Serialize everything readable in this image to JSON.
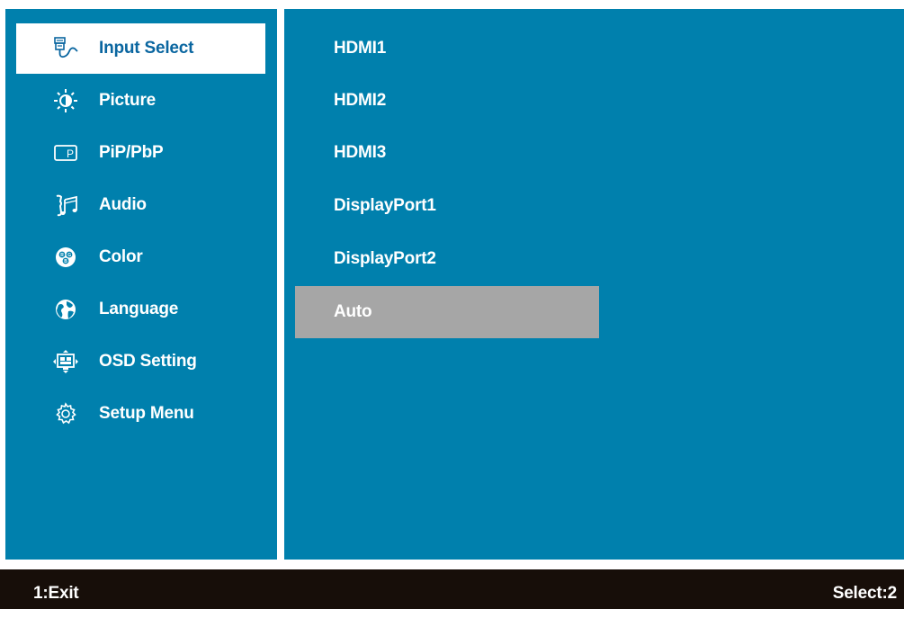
{
  "menu": {
    "items": [
      {
        "label": "Input Select",
        "icon": "input-select-icon",
        "selected": true
      },
      {
        "label": "Picture",
        "icon": "brightness-icon",
        "selected": false
      },
      {
        "label": "PiP/PbP",
        "icon": "pip-icon",
        "selected": false
      },
      {
        "label": "Audio",
        "icon": "audio-icon",
        "selected": false
      },
      {
        "label": "Color",
        "icon": "rgb-color-icon",
        "selected": false
      },
      {
        "label": "Language",
        "icon": "globe-icon",
        "selected": false
      },
      {
        "label": "OSD Setting",
        "icon": "osd-setting-icon",
        "selected": false
      },
      {
        "label": "Setup Menu",
        "icon": "gear-icon",
        "selected": false
      }
    ]
  },
  "input_options": {
    "items": [
      {
        "label": "HDMI1"
      },
      {
        "label": "HDMI2"
      },
      {
        "label": "HDMI3"
      },
      {
        "label": "DisplayPort1"
      },
      {
        "label": "DisplayPort2"
      },
      {
        "label": "Auto",
        "highlighted": true
      }
    ]
  },
  "footer": {
    "exit_hint": "1:Exit",
    "select_hint": "Select:2"
  },
  "colors": {
    "panel": "#0080ad",
    "selected_bg": "#ffffff",
    "selected_text": "#0a66a0",
    "highlight_bg": "#a6a6a6",
    "footer_bg": "#170e09",
    "text": "#ffffff"
  }
}
